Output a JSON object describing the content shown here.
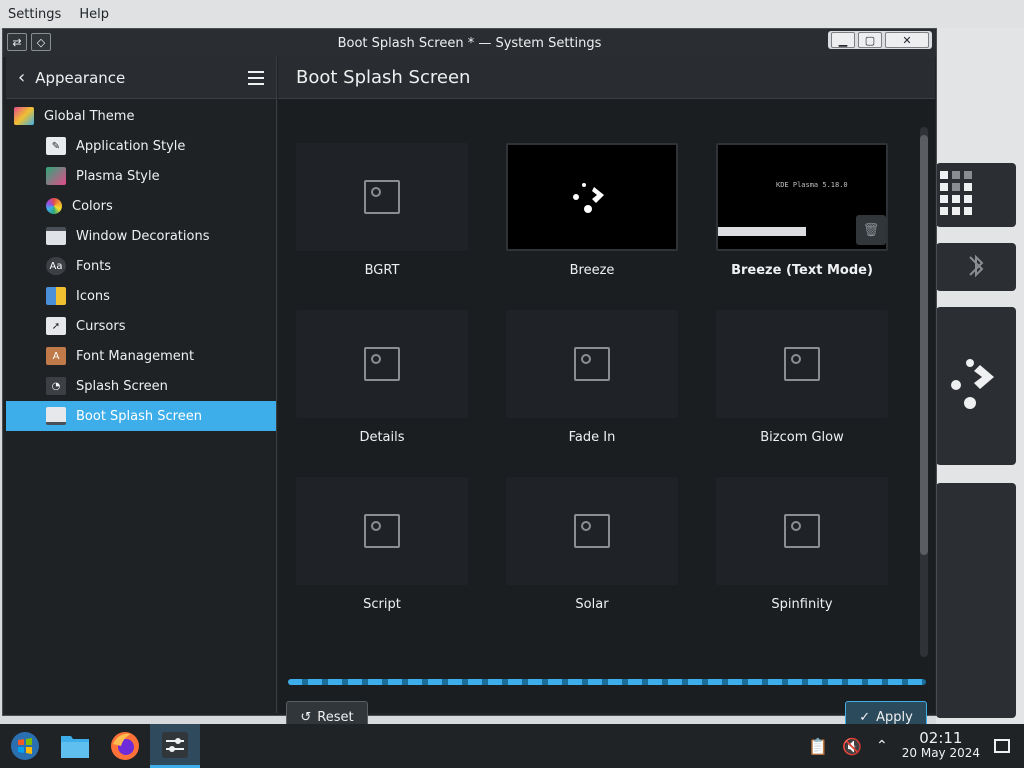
{
  "menubar": {
    "items": [
      "Settings",
      "Help"
    ]
  },
  "window": {
    "title": "Boot Splash Screen * — System Settings"
  },
  "sidebar": {
    "header": "Appearance",
    "items": [
      {
        "label": "Global Theme",
        "icon": "global-theme-icon",
        "color": "#e24a8a"
      },
      {
        "label": "Application Style",
        "icon": "application-style-icon",
        "color": "#e9ecef"
      },
      {
        "label": "Plasma Style",
        "icon": "plasma-style-icon",
        "color": "#2ea87a"
      },
      {
        "label": "Colors",
        "icon": "colors-icon",
        "color": "#f0a030"
      },
      {
        "label": "Window Decorations",
        "icon": "window-decorations-icon",
        "color": "#dfe3e8"
      },
      {
        "label": "Fonts",
        "icon": "fonts-icon",
        "color": "#3c4045"
      },
      {
        "label": "Icons",
        "icon": "icons-icon",
        "color": "#4a90d9"
      },
      {
        "label": "Cursors",
        "icon": "cursors-icon",
        "color": "#e6e8eb"
      },
      {
        "label": "Font Management",
        "icon": "font-management-icon",
        "color": "#c07a4a"
      },
      {
        "label": "Splash Screen",
        "icon": "splash-screen-icon",
        "color": "#3c4045"
      },
      {
        "label": "Boot Splash Screen",
        "icon": "boot-splash-screen-icon",
        "color": "#e6e8eb"
      }
    ]
  },
  "content": {
    "title": "Boot Splash Screen",
    "themes": [
      {
        "label": "BGRT",
        "preview": "placeholder"
      },
      {
        "label": "Breeze",
        "preview": "breeze"
      },
      {
        "label": "Breeze (Text Mode)",
        "preview": "textmode",
        "preview_text": "KDE Plasma 5.18.0"
      },
      {
        "label": "Details",
        "preview": "placeholder"
      },
      {
        "label": "Fade In",
        "preview": "placeholder"
      },
      {
        "label": "Bizcom Glow",
        "preview": "placeholder"
      },
      {
        "label": "Script",
        "preview": "placeholder"
      },
      {
        "label": "Solar",
        "preview": "placeholder"
      },
      {
        "label": "Spinfinity",
        "preview": "placeholder"
      }
    ],
    "reset_label": "Reset",
    "apply_label": "Apply"
  },
  "taskbar": {
    "time": "02:11",
    "date": "20 May 2024"
  },
  "colors": {
    "accent": "#3daee9",
    "window_bg": "#202326"
  }
}
